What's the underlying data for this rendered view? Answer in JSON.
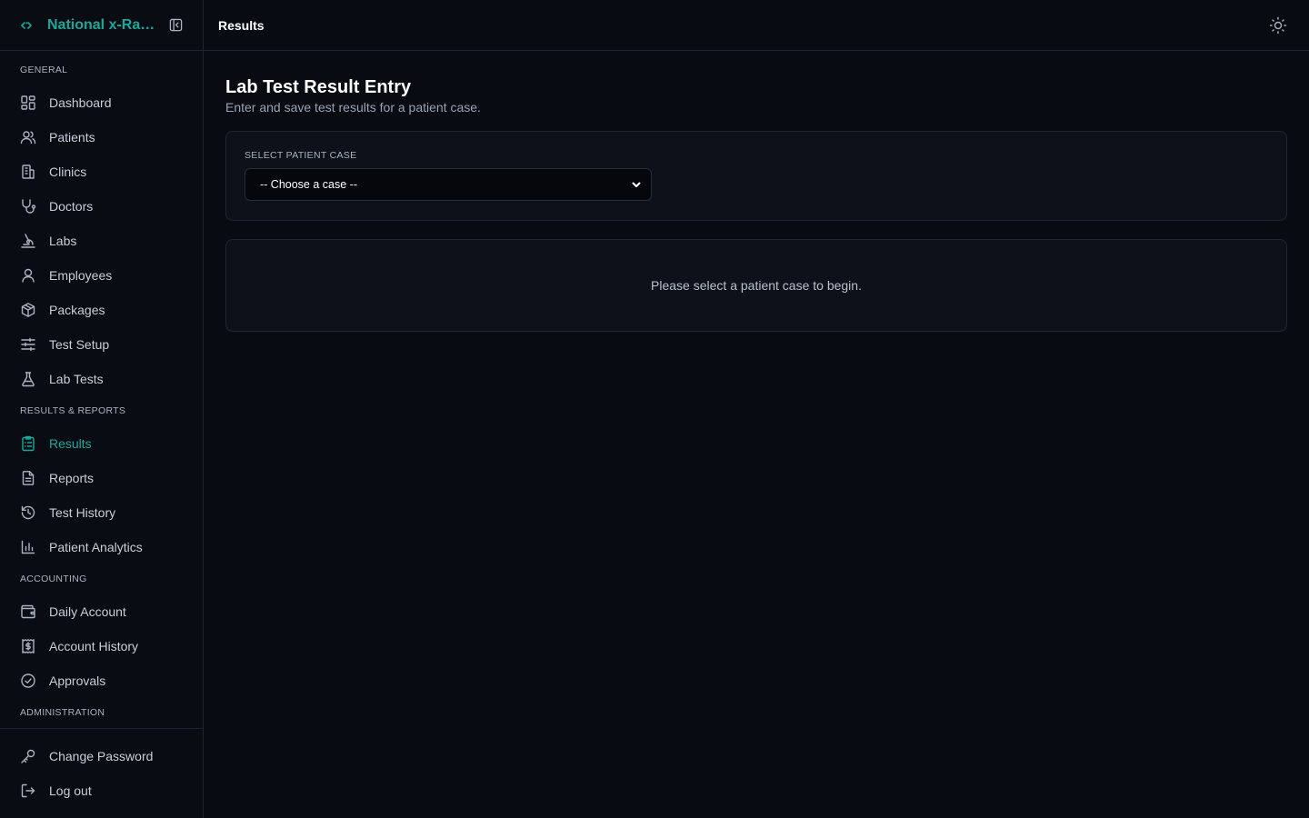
{
  "brand": {
    "name": "National x-Ray..."
  },
  "sidebar": {
    "sections": [
      {
        "label": "General",
        "items": [
          {
            "label": "Dashboard",
            "icon": "dashboard-icon"
          },
          {
            "label": "Patients",
            "icon": "users-icon"
          },
          {
            "label": "Clinics",
            "icon": "building-icon"
          },
          {
            "label": "Doctors",
            "icon": "stethoscope-icon"
          },
          {
            "label": "Labs",
            "icon": "microscope-icon"
          },
          {
            "label": "Employees",
            "icon": "user-icon"
          },
          {
            "label": "Packages",
            "icon": "package-icon"
          },
          {
            "label": "Test Setup",
            "icon": "sliders-icon"
          },
          {
            "label": "Lab Tests",
            "icon": "flask-icon"
          }
        ]
      },
      {
        "label": "Results & Reports",
        "items": [
          {
            "label": "Results",
            "icon": "clipboard-list-icon",
            "active": true
          },
          {
            "label": "Reports",
            "icon": "file-text-icon"
          },
          {
            "label": "Test History",
            "icon": "history-icon"
          },
          {
            "label": "Patient Analytics",
            "icon": "bar-chart-icon"
          }
        ]
      },
      {
        "label": "Accounting",
        "items": [
          {
            "label": "Daily Account",
            "icon": "wallet-icon"
          },
          {
            "label": "Account History",
            "icon": "receipt-dollar-icon"
          },
          {
            "label": "Approvals",
            "icon": "check-circle-icon"
          }
        ]
      },
      {
        "label": "Administration",
        "items": []
      }
    ],
    "footer": [
      {
        "label": "Change Password",
        "icon": "key-icon"
      },
      {
        "label": "Log out",
        "icon": "logout-icon"
      }
    ]
  },
  "header": {
    "title": "Results"
  },
  "page": {
    "title": "Lab Test Result Entry",
    "subtitle": "Enter and save test results for a patient case.",
    "select_label": "Select Patient Case",
    "select_value": "-- Choose a case --",
    "empty_message": "Please select a patient case to begin."
  },
  "colors": {
    "accent": "#1aa89a",
    "background": "#080b12",
    "card": "#0d1119",
    "border": "#1f2632"
  }
}
